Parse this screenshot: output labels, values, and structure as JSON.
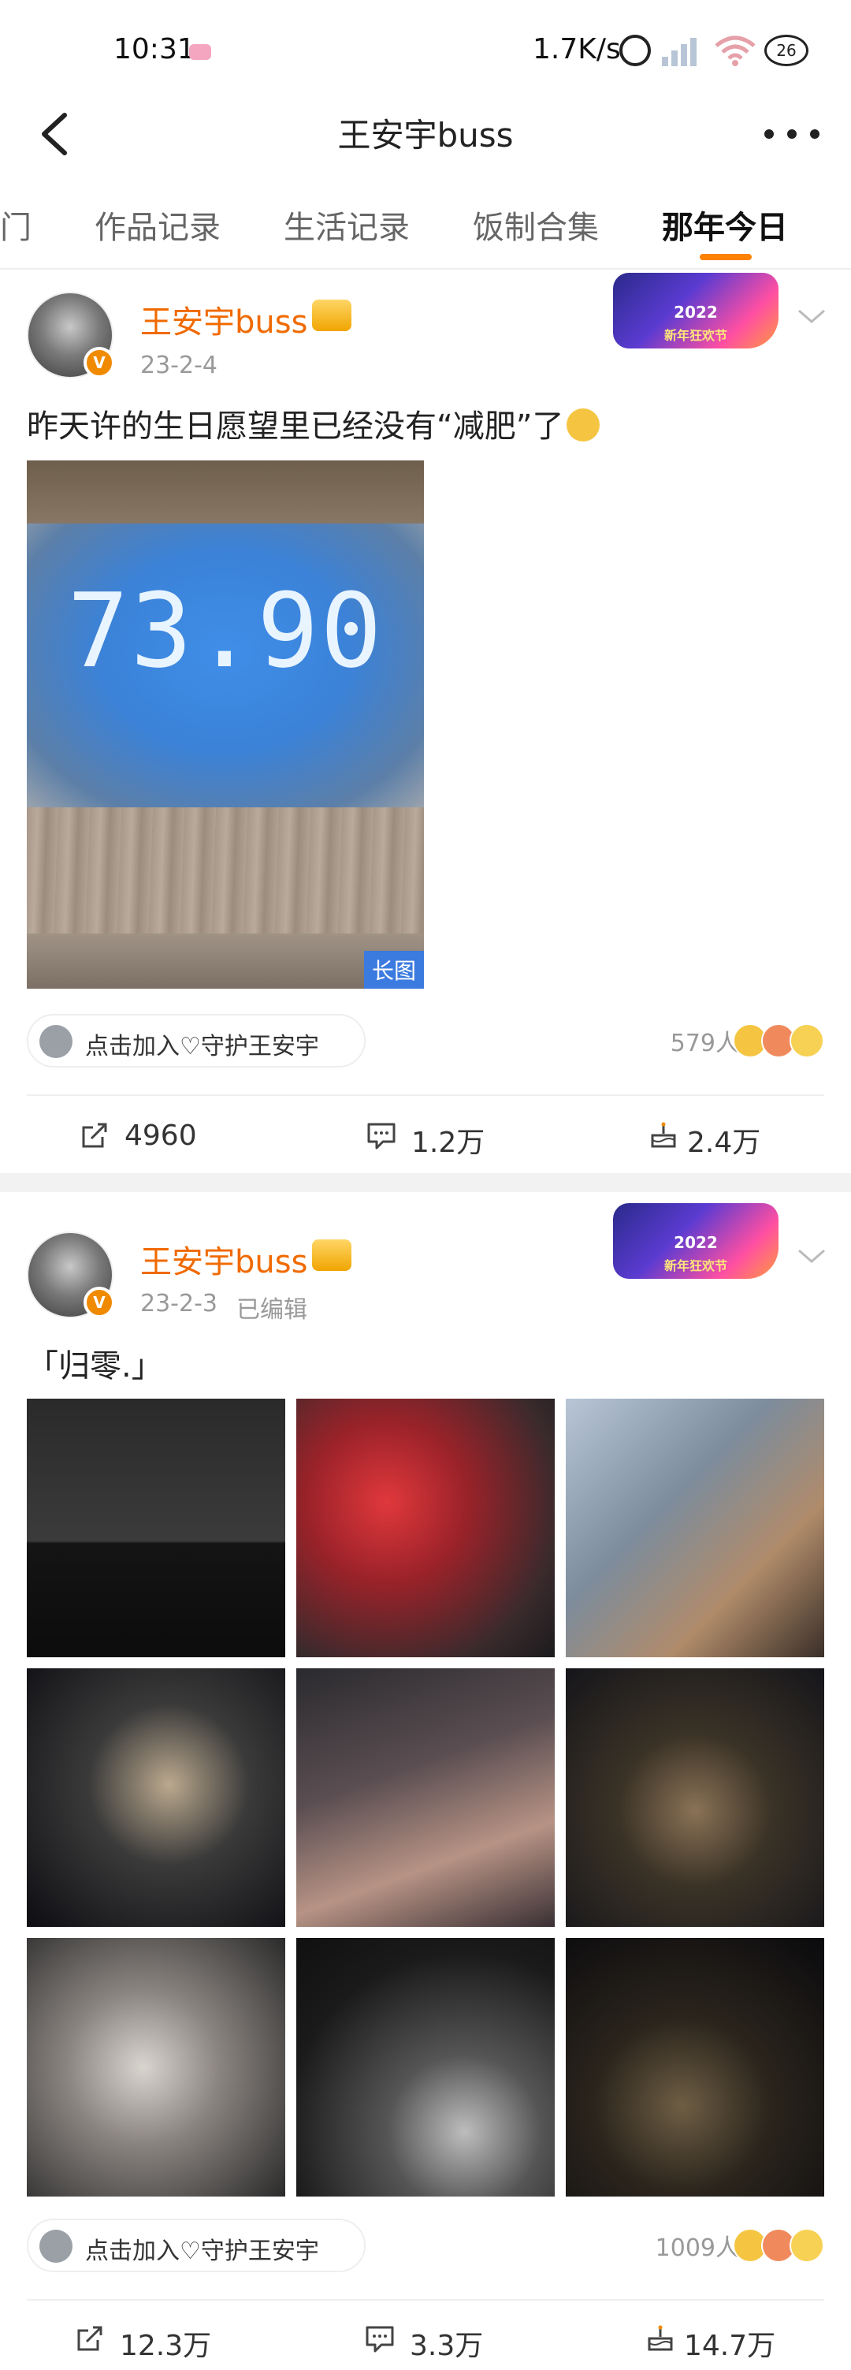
{
  "status_bar": {
    "time": "10:31",
    "net_speed": "1.7K/s",
    "battery": "26"
  },
  "header": {
    "title": "王安宇buss"
  },
  "tabs": [
    {
      "label": "门",
      "active": false
    },
    {
      "label": "作品记录",
      "active": false
    },
    {
      "label": "生活记录",
      "active": false
    },
    {
      "label": "饭制合集",
      "active": false
    },
    {
      "label": "那年今日",
      "active": true
    }
  ],
  "festival_badge": {
    "year": "2022",
    "name": "新年狂欢节"
  },
  "posts": [
    {
      "username": "王安宇buss",
      "date": "23-2-4",
      "edited": "",
      "text": "昨天许的生日愿望里已经没有“减肥”了",
      "photo": {
        "reading": "73.90",
        "label": "长图"
      },
      "guard_label": "点击加入♡守护王安宇",
      "reactors": "579人",
      "reposts": "4960",
      "comments": "1.2万",
      "likes": "2.4万"
    },
    {
      "username": "王安宇buss",
      "date": "23-2-3",
      "edited": "已编辑",
      "text": "「归零.」",
      "guard_label": "点击加入♡守护王安宇",
      "reactors": "1009人",
      "reposts": "12.3万",
      "comments": "3.3万",
      "likes": "14.7万"
    }
  ],
  "colors": {
    "username": "#f06a00",
    "tab_indicator": "#ff8200",
    "long_label_bg": "#3b7be0"
  }
}
